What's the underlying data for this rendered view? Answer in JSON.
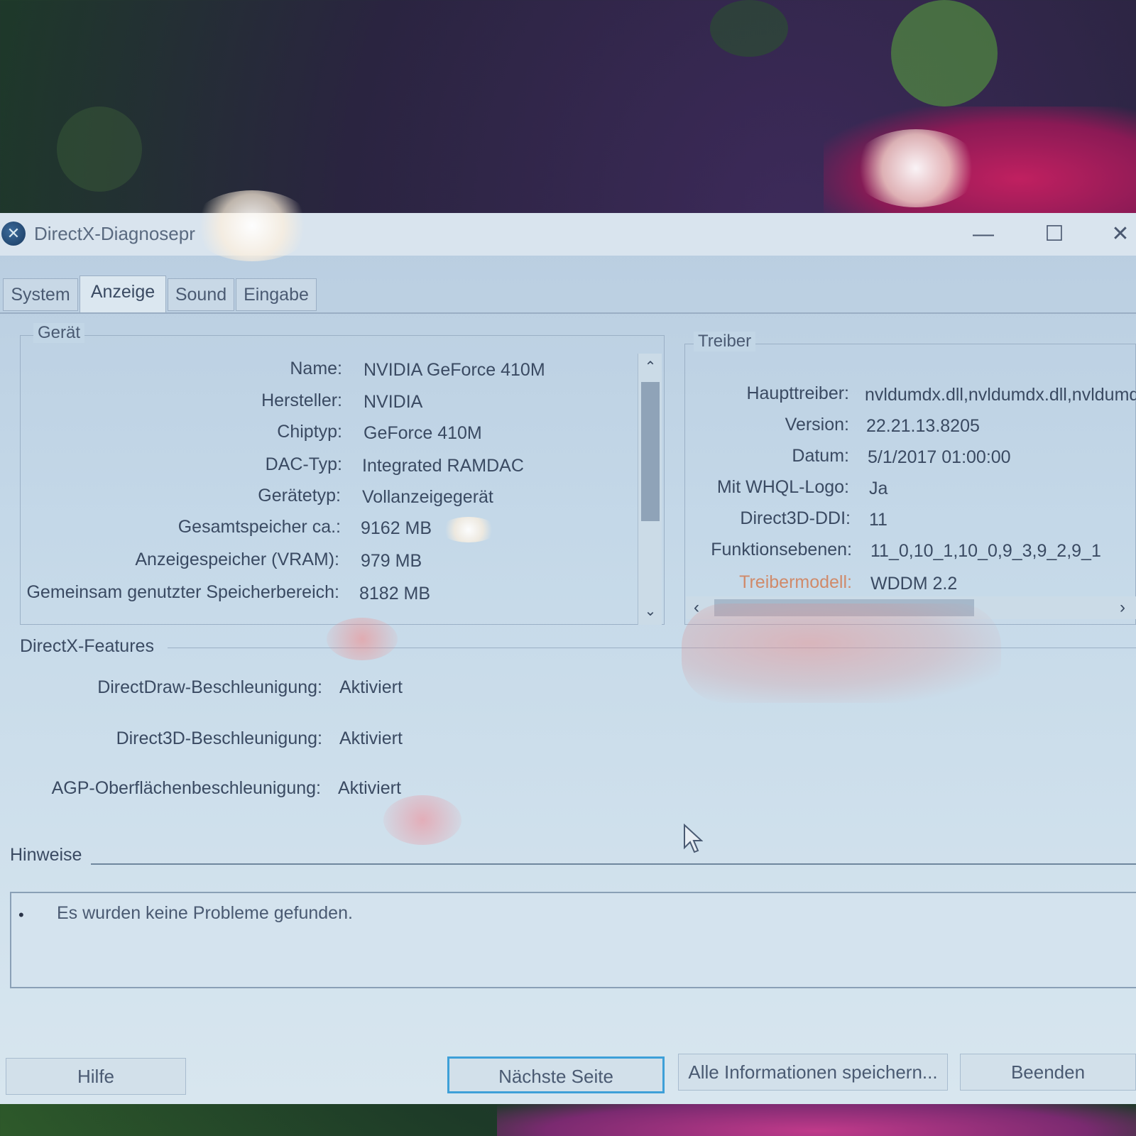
{
  "window": {
    "title": "DirectX-Diagnosepr",
    "icon": "directx-icon",
    "controls": {
      "minimize": "—",
      "maximize": "☐",
      "close": "✕"
    }
  },
  "tabs": [
    {
      "label": "System",
      "active": false
    },
    {
      "label": "Anzeige",
      "active": true
    },
    {
      "label": "Sound",
      "active": false
    },
    {
      "label": "Eingabe",
      "active": false
    }
  ],
  "geraet": {
    "legend": "Gerät",
    "rows": [
      {
        "label": "Name:",
        "value": "NVIDIA GeForce 410M"
      },
      {
        "label": "Hersteller:",
        "value": "NVIDIA"
      },
      {
        "label": "Chiptyp:",
        "value": "GeForce 410M"
      },
      {
        "label": "DAC-Typ:",
        "value": "Integrated RAMDAC"
      },
      {
        "label": "Gerätetyp:",
        "value": "Vollanzeigegerät"
      },
      {
        "label": "Gesamtspeicher ca.:",
        "value": "9162 MB"
      },
      {
        "label": "Anzeigespeicher (VRAM):",
        "value": "979 MB"
      },
      {
        "label": "Gemeinsam genutzter Speicherbereich:",
        "value": "8182 MB"
      }
    ]
  },
  "treiber": {
    "legend": "Treiber",
    "rows": [
      {
        "label": "Haupttreiber:",
        "value": "nvldumdx.dll,nvldumdx.dll,nvldumd"
      },
      {
        "label": "Version:",
        "value": "22.21.13.8205"
      },
      {
        "label": "Datum:",
        "value": "5/1/2017 01:00:00"
      },
      {
        "label": "Mit WHQL-Logo:",
        "value": "Ja"
      },
      {
        "label": "Direct3D-DDI:",
        "value": "11"
      },
      {
        "label": "Funktionsebenen:",
        "value": "11_0,10_1,10_0,9_3,9_2,9_1"
      },
      {
        "label": "Treibermodell:",
        "value": "WDDM 2.2"
      }
    ]
  },
  "features": {
    "title": "DirectX-Features",
    "rows": [
      {
        "label": "DirectDraw-Beschleunigung:",
        "value": "Aktiviert"
      },
      {
        "label": "Direct3D-Beschleunigung:",
        "value": "Aktiviert"
      },
      {
        "label": "AGP-Oberflächenbeschleunigung:",
        "value": "Aktiviert"
      }
    ]
  },
  "hinweise": {
    "title": "Hinweise",
    "items": [
      "Es wurden keine Probleme gefunden."
    ]
  },
  "buttons": {
    "help": "Hilfe",
    "next": "Nächste Seite",
    "save_all": "Alle Informationen speichern...",
    "exit": "Beenden"
  },
  "scroll": {
    "up": "⌃",
    "down": "⌄",
    "left": "‹",
    "right": "›"
  },
  "colors": {
    "accent": "#3ea0d8",
    "window_bg": "#c4d8e8",
    "text": "#3a4a62"
  }
}
